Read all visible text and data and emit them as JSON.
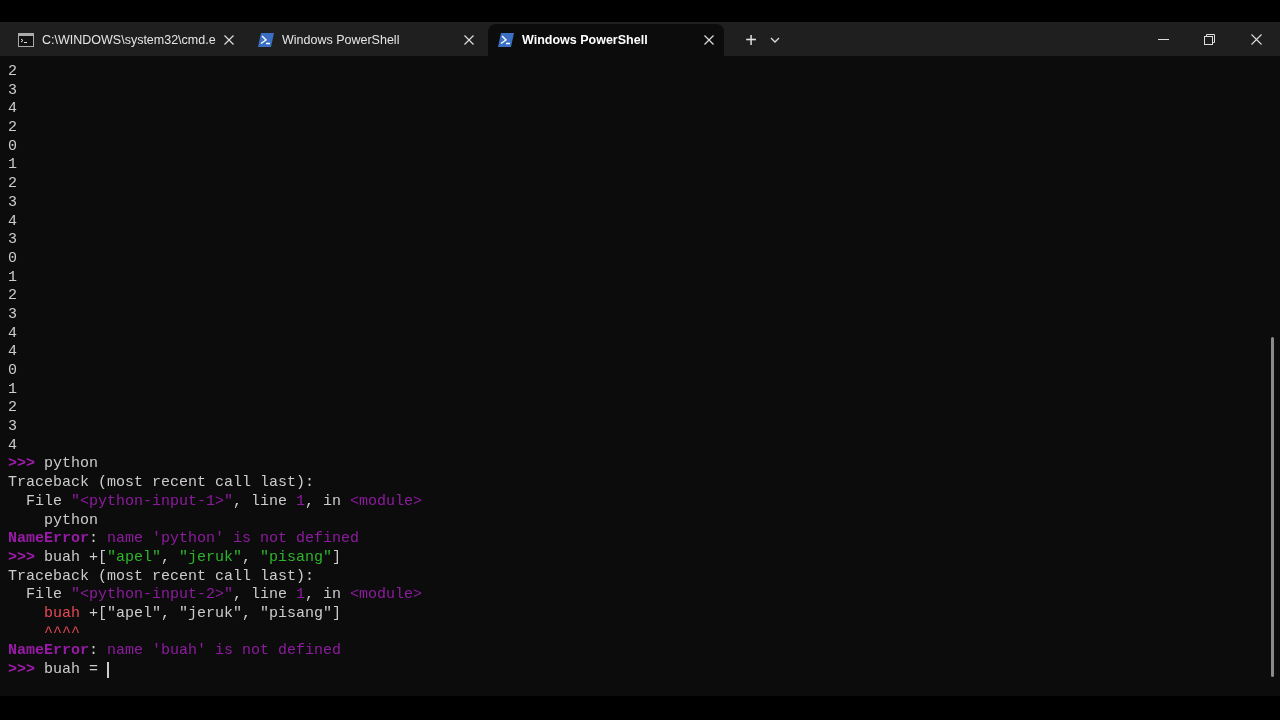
{
  "tabs": [
    {
      "kind": "cmd",
      "title": "C:\\WINDOWS\\system32\\cmd.e",
      "selected": false
    },
    {
      "kind": "powershell",
      "title": "Windows PowerShell",
      "selected": false
    },
    {
      "kind": "powershell",
      "title": "Windows PowerShell",
      "selected": true
    }
  ],
  "new_tab_button": "+",
  "terminal_lines": [
    [
      {
        "kind": "plain",
        "text": "2"
      }
    ],
    [
      {
        "kind": "plain",
        "text": "3"
      }
    ],
    [
      {
        "kind": "plain",
        "text": "4"
      }
    ],
    [
      {
        "kind": "plain",
        "text": "2"
      }
    ],
    [
      {
        "kind": "plain",
        "text": "0"
      }
    ],
    [
      {
        "kind": "plain",
        "text": "1"
      }
    ],
    [
      {
        "kind": "plain",
        "text": "2"
      }
    ],
    [
      {
        "kind": "plain",
        "text": "3"
      }
    ],
    [
      {
        "kind": "plain",
        "text": "4"
      }
    ],
    [
      {
        "kind": "plain",
        "text": "3"
      }
    ],
    [
      {
        "kind": "plain",
        "text": "0"
      }
    ],
    [
      {
        "kind": "plain",
        "text": "1"
      }
    ],
    [
      {
        "kind": "plain",
        "text": "2"
      }
    ],
    [
      {
        "kind": "plain",
        "text": "3"
      }
    ],
    [
      {
        "kind": "plain",
        "text": "4"
      }
    ],
    [
      {
        "kind": "plain",
        "text": "4"
      }
    ],
    [
      {
        "kind": "plain",
        "text": "0"
      }
    ],
    [
      {
        "kind": "plain",
        "text": "1"
      }
    ],
    [
      {
        "kind": "plain",
        "text": "2"
      }
    ],
    [
      {
        "kind": "plain",
        "text": "3"
      }
    ],
    [
      {
        "kind": "plain",
        "text": "4"
      }
    ],
    [
      {
        "kind": "prompt",
        "text": ">>>"
      },
      {
        "kind": "plain",
        "text": " python"
      }
    ],
    [
      {
        "kind": "plain",
        "text": "Traceback (most recent call last):"
      }
    ],
    [
      {
        "kind": "plain",
        "text": "  File "
      },
      {
        "kind": "accent",
        "text": "\"<python-input-1>\""
      },
      {
        "kind": "plain",
        "text": ", line "
      },
      {
        "kind": "accent",
        "text": "1"
      },
      {
        "kind": "plain",
        "text": ", in "
      },
      {
        "kind": "accent",
        "text": "<module>"
      }
    ],
    [
      {
        "kind": "plain",
        "text": "    python"
      }
    ],
    [
      {
        "kind": "error_type",
        "text": "NameError"
      },
      {
        "kind": "plain",
        "text": ": "
      },
      {
        "kind": "accent",
        "text": "name 'python' is not defined"
      }
    ],
    [
      {
        "kind": "prompt",
        "text": ">>>"
      },
      {
        "kind": "plain",
        "text": " buah +["
      },
      {
        "kind": "string",
        "text": "\"apel\""
      },
      {
        "kind": "plain",
        "text": ", "
      },
      {
        "kind": "string",
        "text": "\"jeruk\""
      },
      {
        "kind": "plain",
        "text": ", "
      },
      {
        "kind": "string",
        "text": "\"pisang\""
      },
      {
        "kind": "plain",
        "text": "]"
      }
    ],
    [
      {
        "kind": "plain",
        "text": "Traceback (most recent call last):"
      }
    ],
    [
      {
        "kind": "plain",
        "text": "  File "
      },
      {
        "kind": "accent",
        "text": "\"<python-input-2>\""
      },
      {
        "kind": "plain",
        "text": ", line "
      },
      {
        "kind": "accent",
        "text": "1"
      },
      {
        "kind": "plain",
        "text": ", in "
      },
      {
        "kind": "accent",
        "text": "<module>"
      }
    ],
    [
      {
        "kind": "indent"
      },
      {
        "kind": "error_mark",
        "text": "buah"
      },
      {
        "kind": "plain",
        "text": " +[\"apel\", \"jeruk\", \"pisang\"]"
      }
    ],
    [
      {
        "kind": "indent"
      },
      {
        "kind": "error_mark",
        "text": "^^^^"
      }
    ],
    [
      {
        "kind": "error_type",
        "text": "NameError"
      },
      {
        "kind": "plain",
        "text": ": "
      },
      {
        "kind": "accent",
        "text": "name 'buah' is not defined"
      }
    ],
    [
      {
        "kind": "prompt",
        "text": ">>>"
      },
      {
        "kind": "plain",
        "text": " buah = "
      },
      {
        "kind": "cursor"
      }
    ]
  ]
}
